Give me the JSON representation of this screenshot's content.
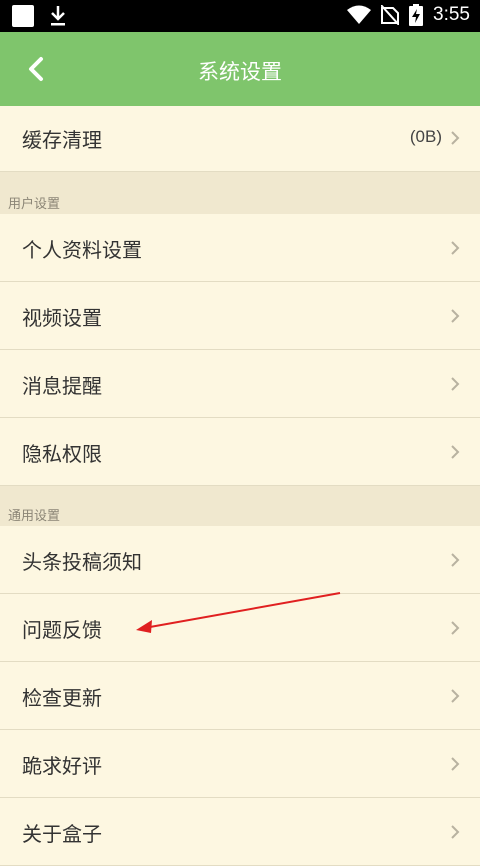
{
  "statusbar": {
    "time": "3:55",
    "icons": [
      "notification-square-icon",
      "download-icon",
      "wifi-icon",
      "no-sim-icon",
      "battery-charging-icon"
    ]
  },
  "appbar": {
    "title": "系统设置",
    "back_icon": "chevron-left-icon"
  },
  "cache": {
    "label": "缓存清理",
    "value": "(0B)"
  },
  "sections": [
    {
      "header": "用户设置",
      "items": [
        "个人资料设置",
        "视频设置",
        "消息提醒",
        "隐私权限"
      ]
    },
    {
      "header": "通用设置",
      "items": [
        "头条投稿须知",
        "问题反馈",
        "检查更新",
        "跪求好评",
        "关于盒子"
      ]
    }
  ],
  "annotation": {
    "arrow_color": "#e02020",
    "target": "问题反馈"
  }
}
